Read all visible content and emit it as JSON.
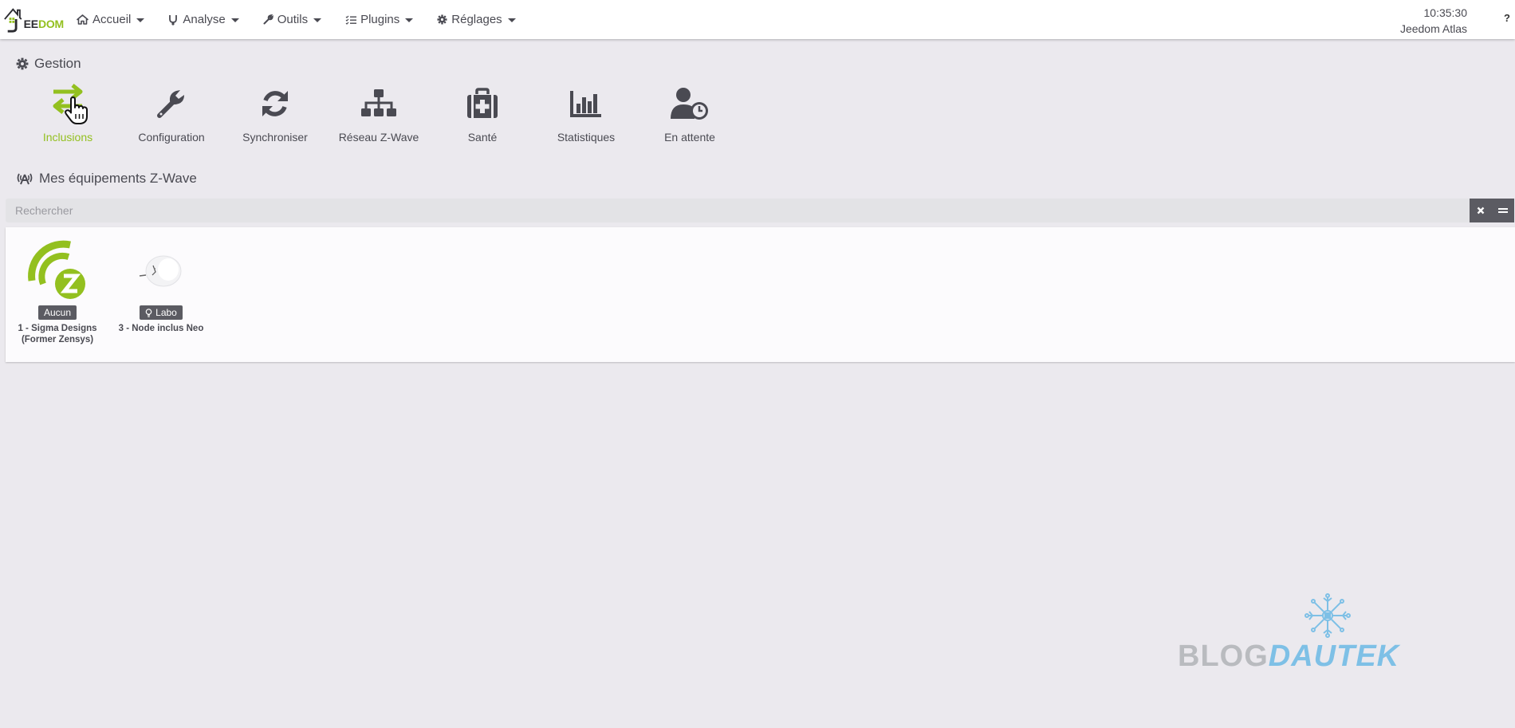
{
  "header": {
    "logo": {
      "main": "EE",
      "accent": "DOM"
    },
    "menu": [
      {
        "label": "Accueil",
        "icon": "home-icon"
      },
      {
        "label": "Analyse",
        "icon": "stethoscope-icon"
      },
      {
        "label": "Outils",
        "icon": "wrench-icon"
      },
      {
        "label": "Plugins",
        "icon": "tasks-icon"
      },
      {
        "label": "Réglages",
        "icon": "gear-icon"
      }
    ],
    "time": "10:35:30",
    "box_name": "Jeedom Atlas",
    "help": "?"
  },
  "gestion": {
    "title": "Gestion",
    "tiles": [
      {
        "label": "Inclusions",
        "icon": "exchange-arrows-icon",
        "active": true
      },
      {
        "label": "Configuration",
        "icon": "wrench-icon"
      },
      {
        "label": "Synchroniser",
        "icon": "sync-icon"
      },
      {
        "label": "Réseau Z-Wave",
        "icon": "sitemap-icon"
      },
      {
        "label": "Santé",
        "icon": "medkit-icon"
      },
      {
        "label": "Statistiques",
        "icon": "bar-chart-icon"
      },
      {
        "label": "En attente",
        "icon": "user-clock-icon"
      }
    ]
  },
  "equipments": {
    "title": "Mes équipements Z-Wave",
    "search_placeholder": "Rechercher",
    "items": [
      {
        "badge": "Aucun",
        "badge_icon": "",
        "name_line1": "1 - Sigma Designs",
        "name_line2": "(Former Zensys)",
        "image": "zwave-logo"
      },
      {
        "badge": "Labo",
        "badge_icon": "lightbulb-icon",
        "name_line1": "3 - Node inclus Neo",
        "name_line2": "",
        "image": "smart-plug"
      }
    ]
  },
  "watermark": {
    "part1": "BLOG",
    "part2": "DAUTEK"
  },
  "colors": {
    "accent": "#93c01f",
    "text": "#4a4a52",
    "background": "#ebe9ee",
    "badge": "#5b5b62"
  }
}
